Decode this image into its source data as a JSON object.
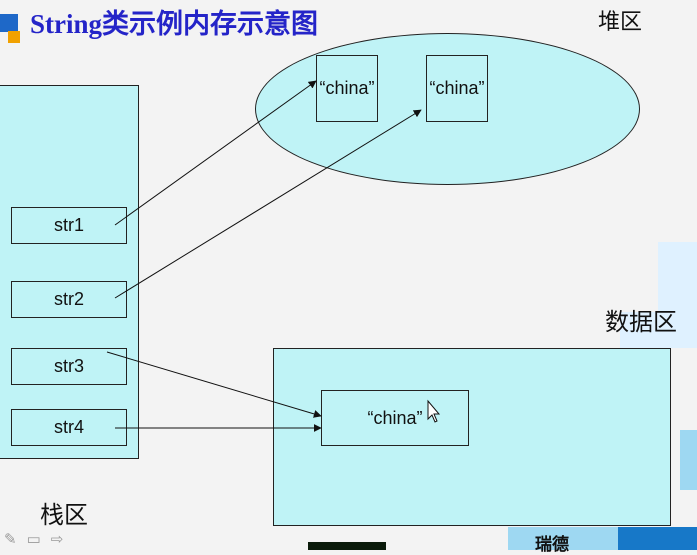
{
  "title": "String类示例内存示意图",
  "regions": {
    "heap": "堆区",
    "data": "数据区",
    "stack": "栈区"
  },
  "heap_objects": [
    "“china”",
    "“china”"
  ],
  "data_object": "“china”",
  "stack_vars": [
    "str1",
    "str2",
    "str3",
    "str4"
  ],
  "footer": {
    "brand": "瑞德",
    "nav_icons": [
      "pen-icon",
      "menu-icon",
      "arrow-right-icon"
    ]
  },
  "colors": {
    "fill": "#bff3f6",
    "title": "#2424c8",
    "accent_blue": "#1778c8",
    "accent_orange": "#f1a100"
  }
}
